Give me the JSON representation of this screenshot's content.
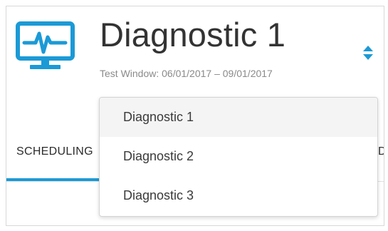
{
  "header": {
    "title": "Diagnostic 1",
    "subtitle": "Test Window: 06/01/2017 – 09/01/2017",
    "icon": "monitor-pulse-icon",
    "icon_color": "#1b9ad6"
  },
  "sort_toggle": {
    "icon": "sort-arrows-icon",
    "color": "#1b9ad6"
  },
  "tabs": [
    {
      "label": "SCHEDULING",
      "active": true
    },
    {
      "label": "D",
      "active": false
    }
  ],
  "accent_color": "#1b9ad6",
  "dropdown": {
    "items": [
      {
        "label": "Diagnostic 1",
        "selected": true
      },
      {
        "label": "Diagnostic 2",
        "selected": false
      },
      {
        "label": "Diagnostic 3",
        "selected": false
      }
    ]
  }
}
